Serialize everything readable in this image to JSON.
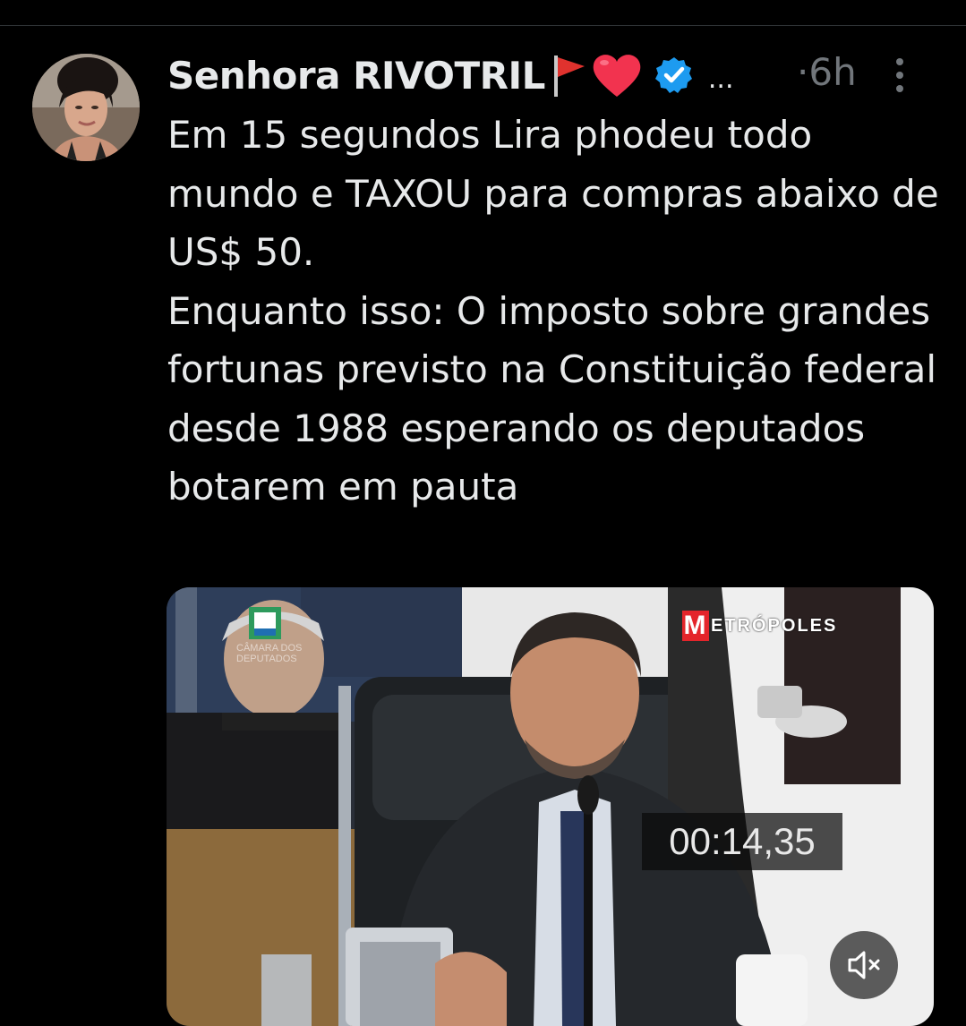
{
  "tweet": {
    "author": {
      "display_name": "Senhora RIVOTRIL",
      "name_emojis": [
        "triangular-flag-icon",
        "red-heart-icon"
      ],
      "verified": true,
      "truncation": "...",
      "separator": "·",
      "time": "6h"
    },
    "text": "Em 15 segundos Lira phodeu todo mundo e TAXOU para compras abaixo de US$ 50.\nEnquanto isso:  O imposto sobre grandes fortunas previsto na Constituição federal desde 1988 esperando os deputados botarem em pauta",
    "media": {
      "watermark_left": "CÂMARA DOS DEPUTADOS",
      "watermark_brand_initial": "M",
      "watermark_brand_rest": "ETRÓPOLES",
      "timer": "00:14,35",
      "muted": true
    }
  },
  "colors": {
    "background": "#000000",
    "text_primary": "#e7e9ea",
    "text_secondary": "#71767b",
    "verified_blue": "#1d9bf0",
    "brand_red": "#e4252b"
  }
}
